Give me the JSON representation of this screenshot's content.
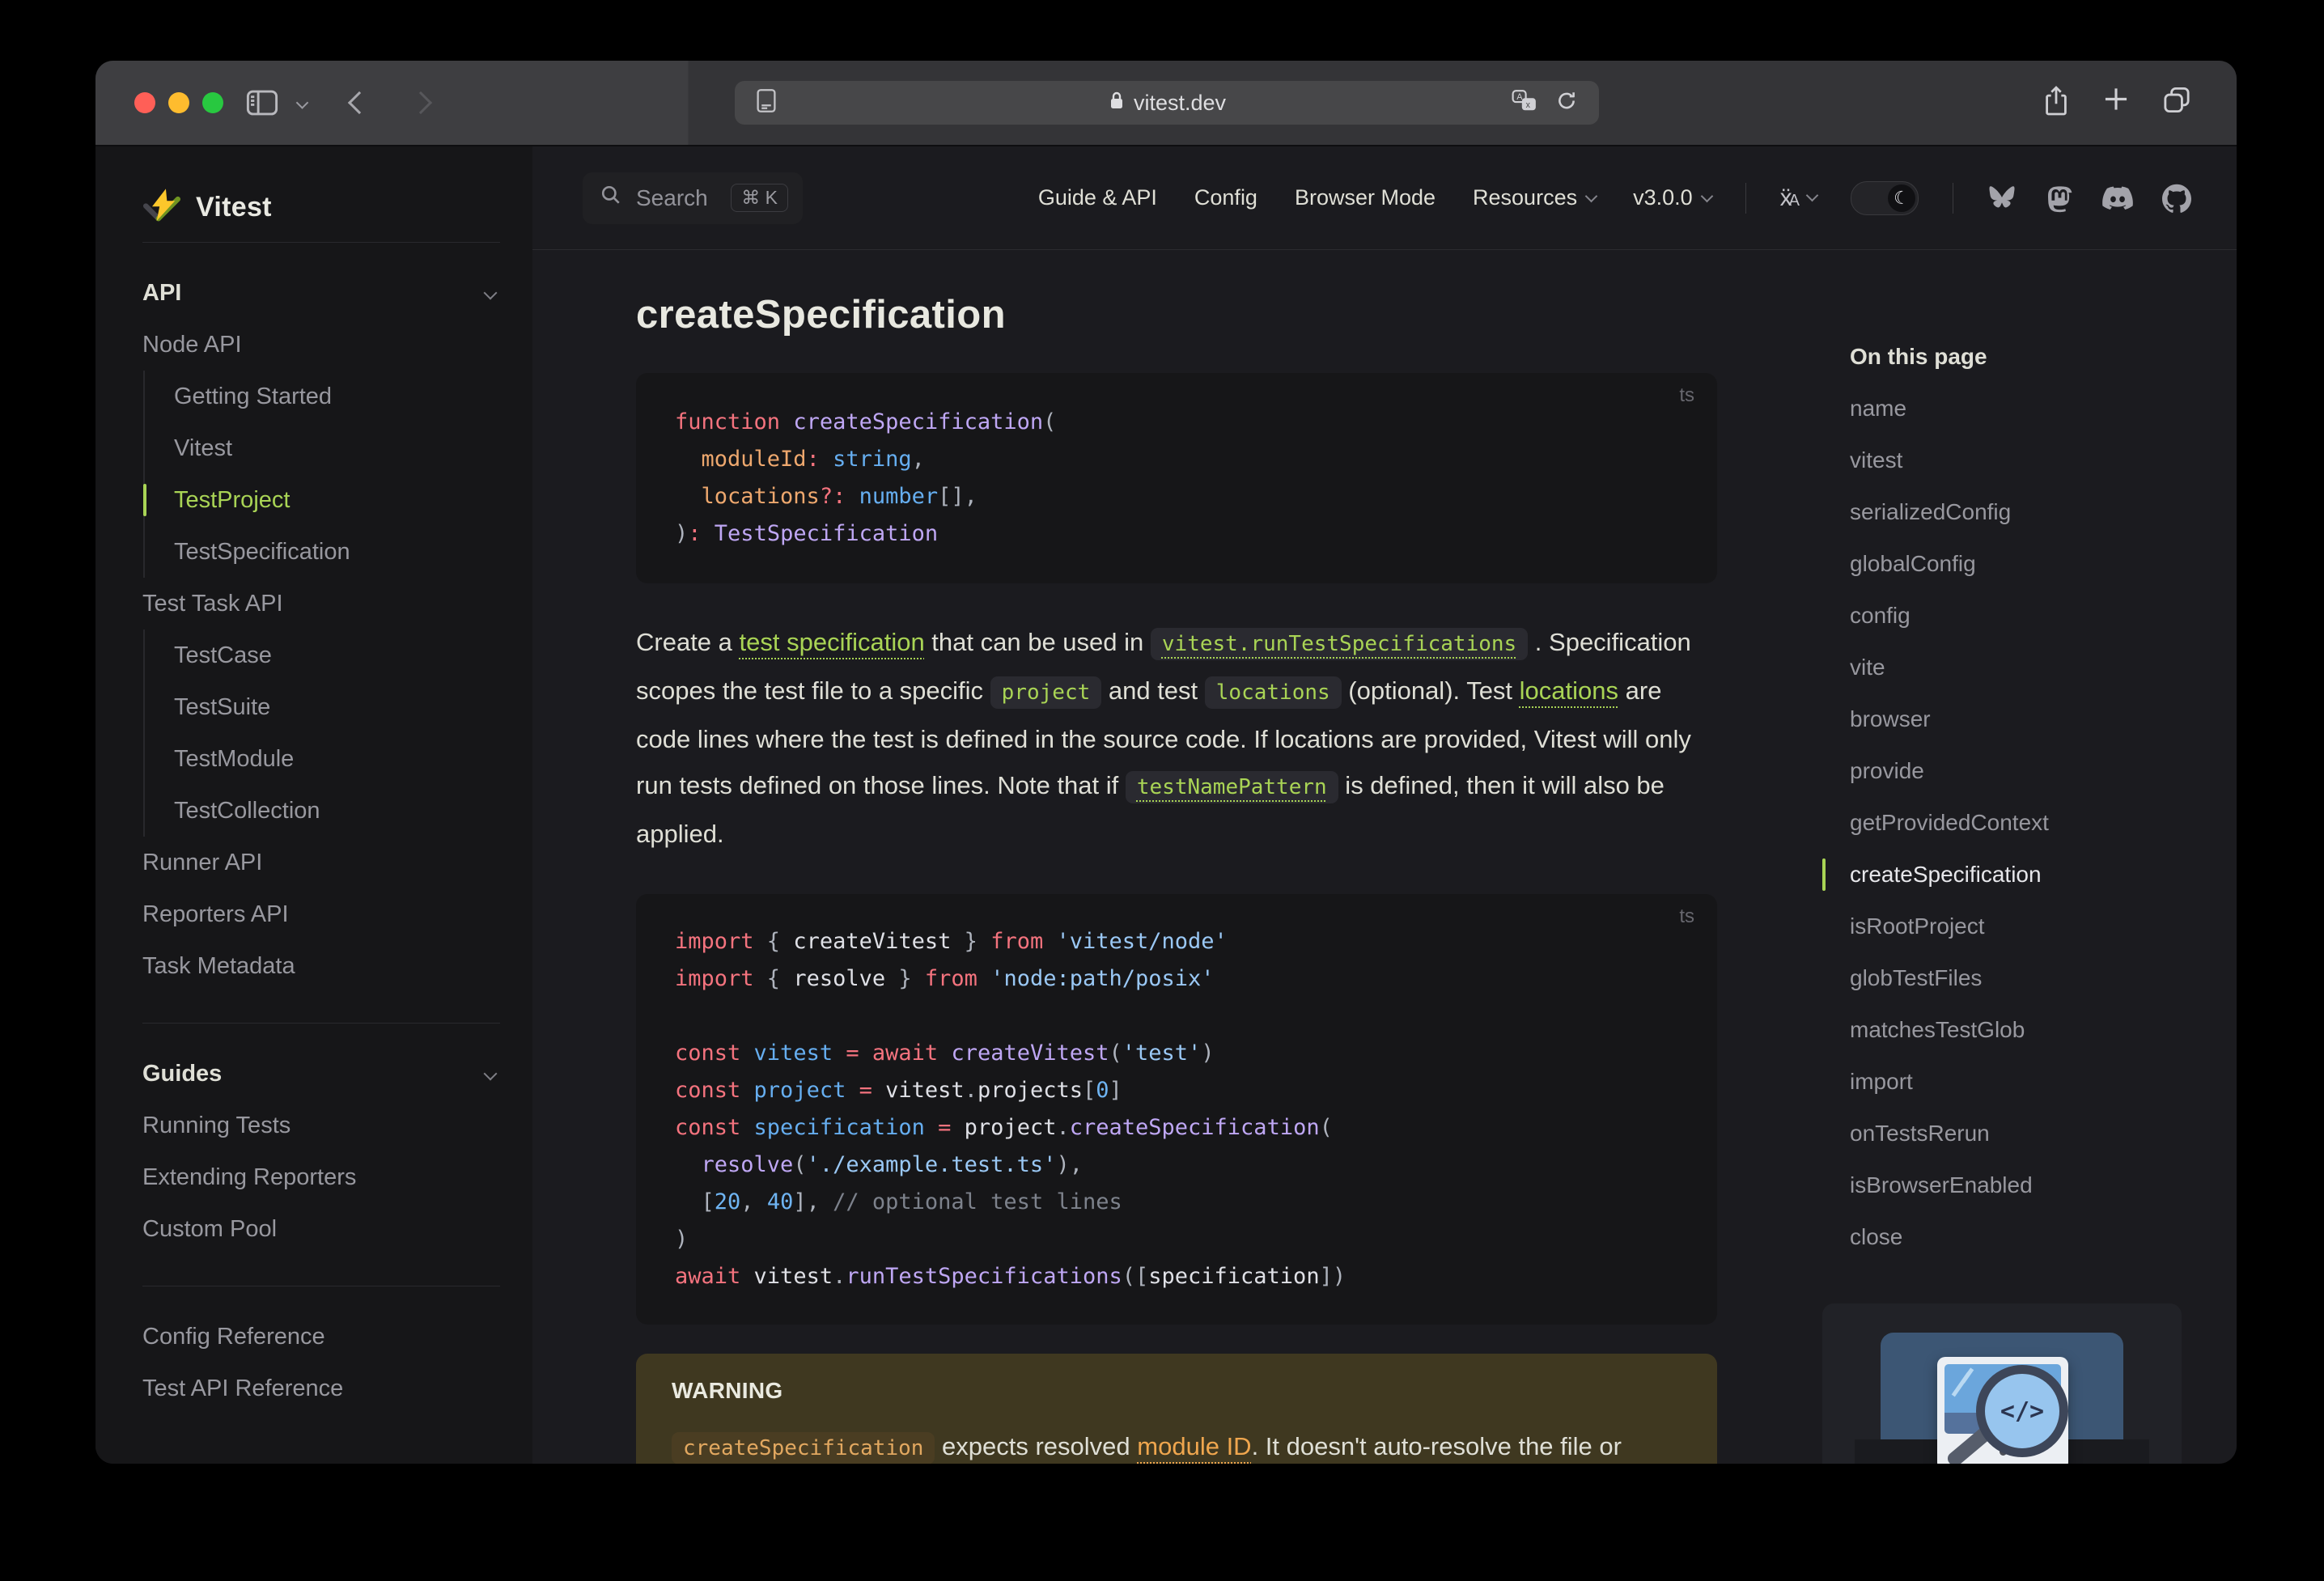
{
  "browser": {
    "url": "vitest.dev"
  },
  "sidebar": {
    "logo_text": "Vitest",
    "sections": [
      {
        "header": "API",
        "items": [
          {
            "label": "Node API",
            "level": 0
          },
          {
            "label": "Getting Started",
            "level": 1
          },
          {
            "label": "Vitest",
            "level": 1
          },
          {
            "label": "TestProject",
            "level": 1,
            "active": true
          },
          {
            "label": "TestSpecification",
            "level": 1
          },
          {
            "label": "Test Task API",
            "level": 0
          },
          {
            "label": "TestCase",
            "level": 1
          },
          {
            "label": "TestSuite",
            "level": 1
          },
          {
            "label": "TestModule",
            "level": 1
          },
          {
            "label": "TestCollection",
            "level": 1
          },
          {
            "label": "Runner API",
            "level": 0
          },
          {
            "label": "Reporters API",
            "level": 0
          },
          {
            "label": "Task Metadata",
            "level": 0
          }
        ]
      },
      {
        "header": "Guides",
        "items": [
          {
            "label": "Running Tests",
            "level": 0
          },
          {
            "label": "Extending Reporters",
            "level": 0
          },
          {
            "label": "Custom Pool",
            "level": 0
          }
        ]
      },
      {
        "header": null,
        "items": [
          {
            "label": "Config Reference",
            "level": 0
          },
          {
            "label": "Test API Reference",
            "level": 0
          }
        ]
      }
    ]
  },
  "nav": {
    "search_label": "Search",
    "search_kbd": "⌘ K",
    "menu": [
      {
        "label": "Guide & API",
        "chevron": false
      },
      {
        "label": "Config",
        "chevron": false
      },
      {
        "label": "Browser Mode",
        "chevron": false
      },
      {
        "label": "Resources",
        "chevron": true
      },
      {
        "label": "v3.0.0",
        "chevron": true
      }
    ]
  },
  "doc": {
    "title": "createSpecification",
    "code1": {
      "lang": "ts",
      "lines": [
        [
          [
            "kw",
            "function"
          ],
          [
            "pl",
            " "
          ],
          [
            "fn",
            "createSpecification"
          ],
          [
            "pu",
            "("
          ]
        ],
        [
          [
            "pl",
            "  "
          ],
          [
            "vo",
            "moduleId"
          ],
          [
            "kw",
            ":"
          ],
          [
            "pl",
            " "
          ],
          [
            "vb",
            "string"
          ],
          [
            "pu",
            ","
          ]
        ],
        [
          [
            "pl",
            "  "
          ],
          [
            "vo",
            "locations"
          ],
          [
            "kw",
            "?:"
          ],
          [
            "pl",
            " "
          ],
          [
            "vb",
            "number"
          ],
          [
            "pu",
            "[],"
          ]
        ],
        [
          [
            "pu",
            ")"
          ],
          [
            "kw",
            ":"
          ],
          [
            "pl",
            " "
          ],
          [
            "fn",
            "TestSpecification"
          ]
        ]
      ]
    },
    "paragraph": [
      {
        "s": "text",
        "t": "Create a "
      },
      {
        "s": "link",
        "t": "test specification"
      },
      {
        "s": "text",
        "t": " that can be used in "
      },
      {
        "s": "codelink",
        "t": "vitest.runTestSpecifications"
      },
      {
        "s": "text",
        "t": " . Specification scopes the test file to a specific "
      },
      {
        "s": "code",
        "t": "project"
      },
      {
        "s": "text",
        "t": " and test "
      },
      {
        "s": "code",
        "t": "locations"
      },
      {
        "s": "text",
        "t": " (optional). Test "
      },
      {
        "s": "link",
        "t": "locations"
      },
      {
        "s": "text",
        "t": " are code lines where the test is defined in the source code. If locations are provided, Vitest will only run tests defined on those lines. Note that if "
      },
      {
        "s": "codelink",
        "t": "testNamePattern"
      },
      {
        "s": "text",
        "t": " is defined, then it will also be applied."
      }
    ],
    "code2": {
      "lang": "ts",
      "lines": [
        [
          [
            "kw",
            "import"
          ],
          [
            "pu",
            " { "
          ],
          [
            "pl",
            "createVitest"
          ],
          [
            "pu",
            " } "
          ],
          [
            "kw",
            "from"
          ],
          [
            "pl",
            " "
          ],
          [
            "st",
            "'vitest/node'"
          ]
        ],
        [
          [
            "kw",
            "import"
          ],
          [
            "pu",
            " { "
          ],
          [
            "pl",
            "resolve"
          ],
          [
            "pu",
            " } "
          ],
          [
            "kw",
            "from"
          ],
          [
            "pl",
            " "
          ],
          [
            "st",
            "'node:path/posix'"
          ]
        ],
        [],
        [
          [
            "kw",
            "const"
          ],
          [
            "pl",
            " "
          ],
          [
            "vb",
            "vitest"
          ],
          [
            "pl",
            " "
          ],
          [
            "kw",
            "="
          ],
          [
            "pl",
            " "
          ],
          [
            "kw",
            "await"
          ],
          [
            "pl",
            " "
          ],
          [
            "fn",
            "createVitest"
          ],
          [
            "pu",
            "("
          ],
          [
            "st",
            "'test'"
          ],
          [
            "pu",
            ")"
          ]
        ],
        [
          [
            "kw",
            "const"
          ],
          [
            "pl",
            " "
          ],
          [
            "vb",
            "project"
          ],
          [
            "pl",
            " "
          ],
          [
            "kw",
            "="
          ],
          [
            "pl",
            " "
          ],
          [
            "pl",
            "vitest"
          ],
          [
            "pu",
            "."
          ],
          [
            "pl",
            "projects"
          ],
          [
            "pu",
            "["
          ],
          [
            "nu",
            "0"
          ],
          [
            "pu",
            "]"
          ]
        ],
        [
          [
            "kw",
            "const"
          ],
          [
            "pl",
            " "
          ],
          [
            "vb",
            "specification"
          ],
          [
            "pl",
            " "
          ],
          [
            "kw",
            "="
          ],
          [
            "pl",
            " "
          ],
          [
            "pl",
            "project"
          ],
          [
            "pu",
            "."
          ],
          [
            "fn",
            "createSpecification"
          ],
          [
            "pu",
            "("
          ]
        ],
        [
          [
            "pl",
            "  "
          ],
          [
            "fn",
            "resolve"
          ],
          [
            "pu",
            "("
          ],
          [
            "st",
            "'./example.test.ts'"
          ],
          [
            "pu",
            "),"
          ]
        ],
        [
          [
            "pl",
            "  "
          ],
          [
            "pu",
            "["
          ],
          [
            "nu",
            "20"
          ],
          [
            "pu",
            ", "
          ],
          [
            "nu",
            "40"
          ],
          [
            "pu",
            "], "
          ],
          [
            "cm",
            "// optional test lines"
          ]
        ],
        [
          [
            "pu",
            ")"
          ]
        ],
        [
          [
            "kw",
            "await"
          ],
          [
            "pl",
            " "
          ],
          [
            "pl",
            "vitest"
          ],
          [
            "pu",
            "."
          ],
          [
            "fn",
            "runTestSpecifications"
          ],
          [
            "pu",
            "(["
          ],
          [
            "pl",
            "specification"
          ],
          [
            "pu",
            "])"
          ]
        ]
      ]
    },
    "warning": {
      "title": "WARNING",
      "segments": [
        {
          "s": "wcode",
          "t": "createSpecification"
        },
        {
          "s": "text",
          "t": " expects resolved "
        },
        {
          "s": "wlink",
          "t": "module ID"
        },
        {
          "s": "text",
          "t": ". It doesn't auto-resolve the file or check that it exists on the file system."
        }
      ]
    }
  },
  "aside": {
    "title": "On this page",
    "items": [
      {
        "label": "name"
      },
      {
        "label": "vitest"
      },
      {
        "label": "serializedConfig"
      },
      {
        "label": "globalConfig"
      },
      {
        "label": "config"
      },
      {
        "label": "vite"
      },
      {
        "label": "browser"
      },
      {
        "label": "provide"
      },
      {
        "label": "getProvidedContext"
      },
      {
        "label": "createSpecification",
        "active": true
      },
      {
        "label": "isRootProject"
      },
      {
        "label": "globTestFiles"
      },
      {
        "label": "matchesTestGlob"
      },
      {
        "label": "import"
      },
      {
        "label": "onTestsRerun"
      },
      {
        "label": "isBrowserEnabled"
      },
      {
        "label": "close"
      }
    ]
  },
  "colors": {
    "accent_green": "#a9d455",
    "warning_bg": "#3f3820",
    "code_bg": "#161618",
    "page_bg": "#1b1b1f"
  }
}
